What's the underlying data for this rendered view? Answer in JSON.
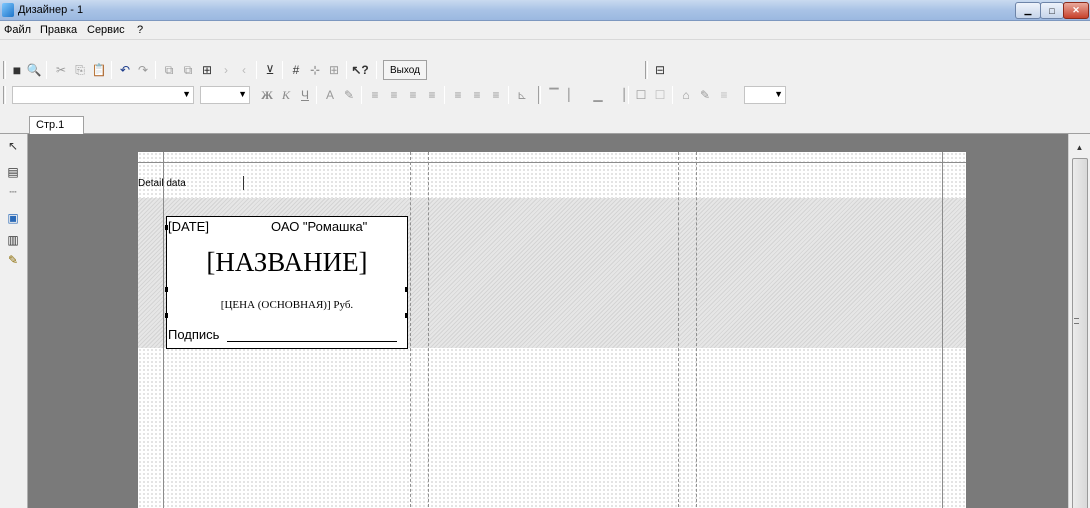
{
  "window": {
    "title": "Дизайнер - 1"
  },
  "menu": [
    "Файл",
    "Правка",
    "Сервис",
    "?"
  ],
  "toolbar": {
    "exit_label": "Выход",
    "bold_glyph": "Ж",
    "italic_glyph": "К",
    "underline_glyph": "Ч"
  },
  "tabs": [
    "Стр.1"
  ],
  "band": {
    "label": "Detail data"
  },
  "label_card": {
    "date": "[DATE]",
    "org": "ОАО \"Ромашка\"",
    "name": "[НАЗВАНИЕ]",
    "price": "[ЦЕНА (ОСНОВНАЯ)] Руб.",
    "signature": "Подпись"
  },
  "icons": {
    "save": "save-icon",
    "preview": "print-preview-icon",
    "cut": "cut-icon",
    "copy": "copy-icon",
    "paste": "paste-icon",
    "undo": "undo-icon",
    "redo": "redo-icon",
    "grid": "grid-icon",
    "help": "help-icon"
  }
}
